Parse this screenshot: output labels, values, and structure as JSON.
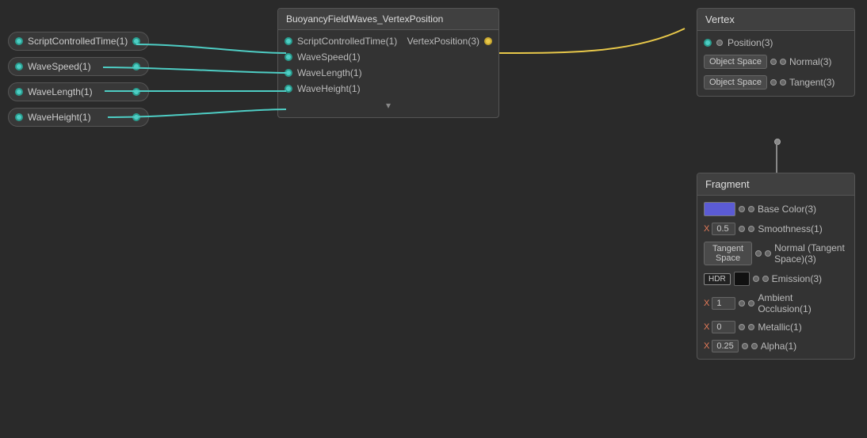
{
  "leftNodes": {
    "items": [
      {
        "label": "ScriptControlledTime(1)",
        "id": "script-controlled-time"
      },
      {
        "label": "WaveSpeed(1)",
        "id": "wave-speed"
      },
      {
        "label": "WaveLength(1)",
        "id": "wave-length"
      },
      {
        "label": "WaveHeight(1)",
        "id": "wave-height"
      }
    ]
  },
  "middleNode": {
    "title": "BuoyancyFieldWaves_VertexPosition",
    "inputs": [
      {
        "label": "ScriptControlledTime(1)"
      },
      {
        "label": "WaveSpeed(1)"
      },
      {
        "label": "WaveLength(1)"
      },
      {
        "label": "WaveHeight(1)"
      }
    ],
    "output": {
      "label": "VertexPosition(3)"
    },
    "footer": "▾"
  },
  "vertexNode": {
    "title": "Vertex",
    "rows": [
      {
        "label": "Position(3)",
        "hasLeftDot": true
      },
      {
        "label": "Normal(3)",
        "hasLeftDot": true,
        "button": "Object Space"
      },
      {
        "label": "Tangent(3)",
        "hasLeftDot": true,
        "button": "Object Space"
      }
    ]
  },
  "fragmentNode": {
    "title": "Fragment",
    "rows": [
      {
        "label": "Base Color(3)",
        "hasLeftDot": true,
        "control": "color"
      },
      {
        "label": "Smoothness(1)",
        "hasLeftDot": true,
        "control": "number",
        "numLabel": "X",
        "numVal": "0.5"
      },
      {
        "label": "Normal (Tangent Space)(3)",
        "hasLeftDot": true,
        "button": "Tangent Space"
      },
      {
        "label": "Emission(3)",
        "hasLeftDot": true,
        "control": "hdr"
      },
      {
        "label": "Ambient Occlusion(1)",
        "hasLeftDot": true,
        "control": "number",
        "numLabel": "X",
        "numVal": "1"
      },
      {
        "label": "Metallic(1)",
        "hasLeftDot": true,
        "control": "number",
        "numLabel": "X",
        "numVal": "0"
      },
      {
        "label": "Alpha(1)",
        "hasLeftDot": true,
        "control": "number",
        "numLabel": "X",
        "numVal": "0.25"
      }
    ]
  },
  "colors": {
    "background": "#2a2a2a",
    "nodeBackground": "#333",
    "nodeTitleBackground": "#404040",
    "dotCyan": "#4ecdc4",
    "dotYellow": "#e8c84a",
    "connectionColor": "#4ecdc4",
    "connectionYellow": "#e8c84a"
  }
}
